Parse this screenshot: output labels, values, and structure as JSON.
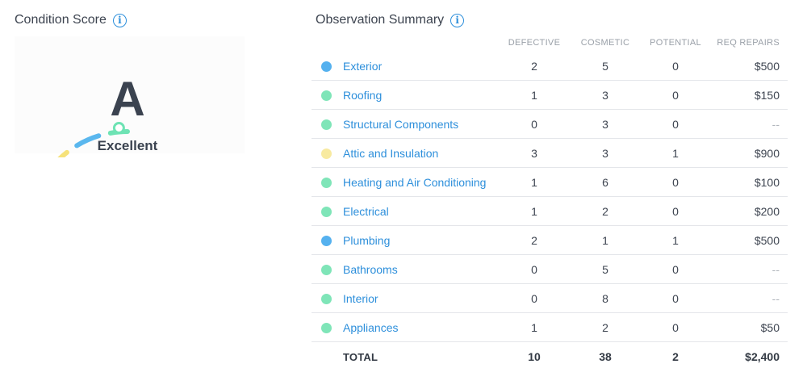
{
  "condition_score": {
    "title": "Condition Score",
    "grade": "A",
    "grade_label": "Excellent",
    "gauge_colors": [
      "#ec8482",
      "#f0b35a",
      "#f6e27a",
      "#5ab7ee",
      "#6ee3b4"
    ]
  },
  "observation_summary": {
    "title": "Observation Summary",
    "columns": [
      "DEFECTIVE",
      "COSMETIC",
      "POTENTIAL",
      "REQ REPAIRS"
    ],
    "rows": [
      {
        "name": "Exterior",
        "color": "#55b1ef",
        "defective": "2",
        "cosmetic": "5",
        "potential": "0",
        "repairs": "$500"
      },
      {
        "name": "Roofing",
        "color": "#7fe5b8",
        "defective": "1",
        "cosmetic": "3",
        "potential": "0",
        "repairs": "$150"
      },
      {
        "name": "Structural Components",
        "color": "#7fe5b8",
        "defective": "0",
        "cosmetic": "3",
        "potential": "0",
        "repairs": "--"
      },
      {
        "name": "Attic and Insulation",
        "color": "#f8eaa0",
        "defective": "3",
        "cosmetic": "3",
        "potential": "1",
        "repairs": "$900"
      },
      {
        "name": "Heating and Air Conditioning",
        "color": "#7fe5b8",
        "defective": "1",
        "cosmetic": "6",
        "potential": "0",
        "repairs": "$100"
      },
      {
        "name": "Electrical",
        "color": "#7fe5b8",
        "defective": "1",
        "cosmetic": "2",
        "potential": "0",
        "repairs": "$200"
      },
      {
        "name": "Plumbing",
        "color": "#55b1ef",
        "defective": "2",
        "cosmetic": "1",
        "potential": "1",
        "repairs": "$500"
      },
      {
        "name": "Bathrooms",
        "color": "#7fe5b8",
        "defective": "0",
        "cosmetic": "5",
        "potential": "0",
        "repairs": "--"
      },
      {
        "name": "Interior",
        "color": "#7fe5b8",
        "defective": "0",
        "cosmetic": "8",
        "potential": "0",
        "repairs": "--"
      },
      {
        "name": "Appliances",
        "color": "#7fe5b8",
        "defective": "1",
        "cosmetic": "2",
        "potential": "0",
        "repairs": "$50"
      }
    ],
    "total": {
      "label": "TOTAL",
      "defective": "10",
      "cosmetic": "38",
      "potential": "2",
      "repairs": "$2,400"
    }
  }
}
